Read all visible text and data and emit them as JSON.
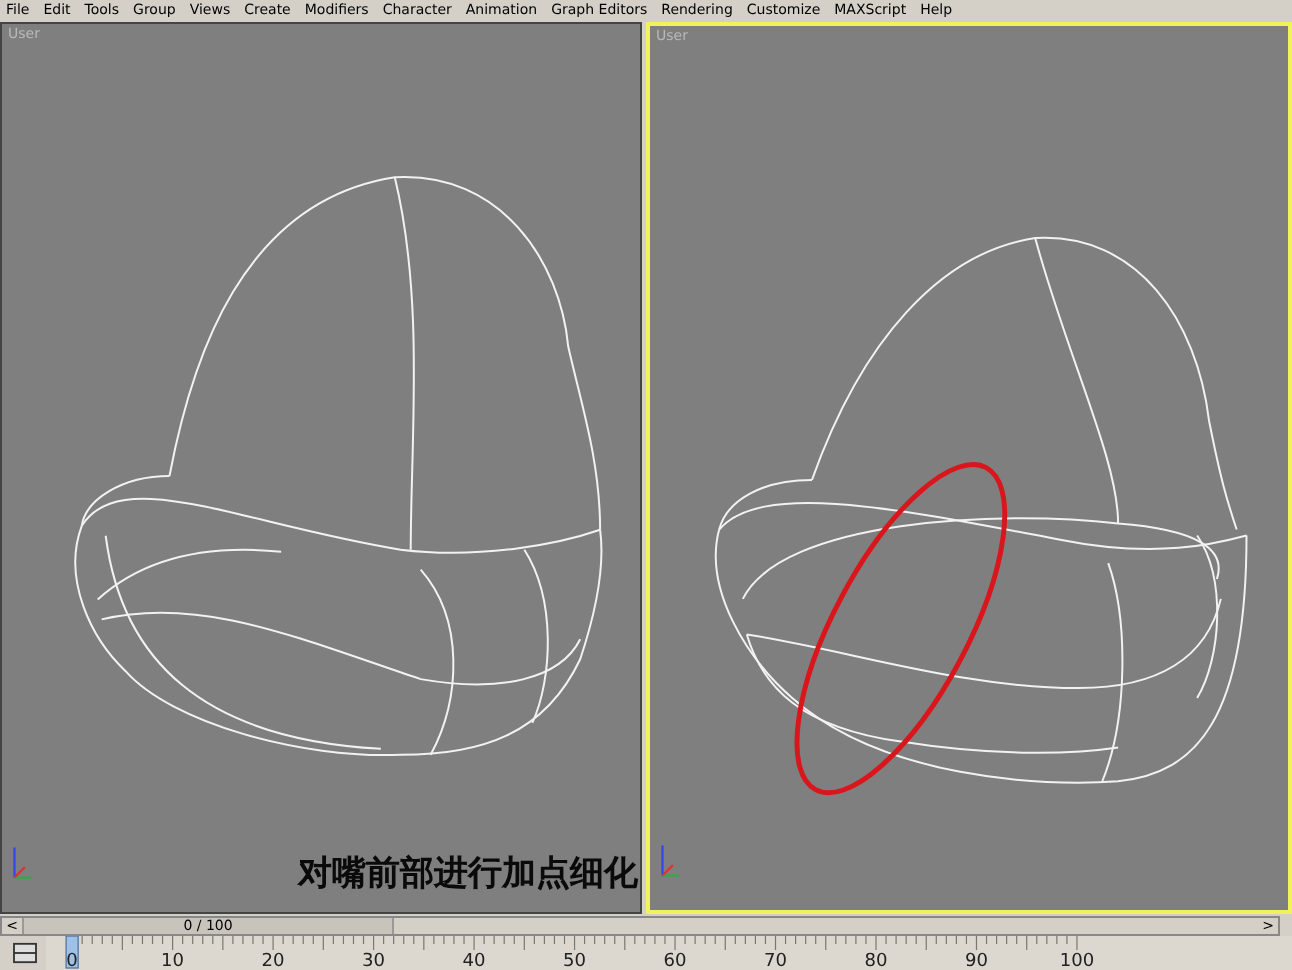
{
  "menu": [
    "File",
    "Edit",
    "Tools",
    "Group",
    "Views",
    "Create",
    "Modifiers",
    "Character",
    "Animation",
    "Graph Editors",
    "Rendering",
    "Customize",
    "MAXScript",
    "Help"
  ],
  "viewports": [
    {
      "label": "User",
      "selected": false
    },
    {
      "label": "User",
      "selected": true
    }
  ],
  "caption": "对嘴前部进行加点细化",
  "time_slider": {
    "prev": "<",
    "readout": "0 / 100",
    "next": ">",
    "level": 0
  },
  "timeline": {
    "ticks": [
      "0",
      "10",
      "20",
      "30",
      "40",
      "50",
      "60",
      "70",
      "80",
      "90",
      "100"
    ]
  }
}
